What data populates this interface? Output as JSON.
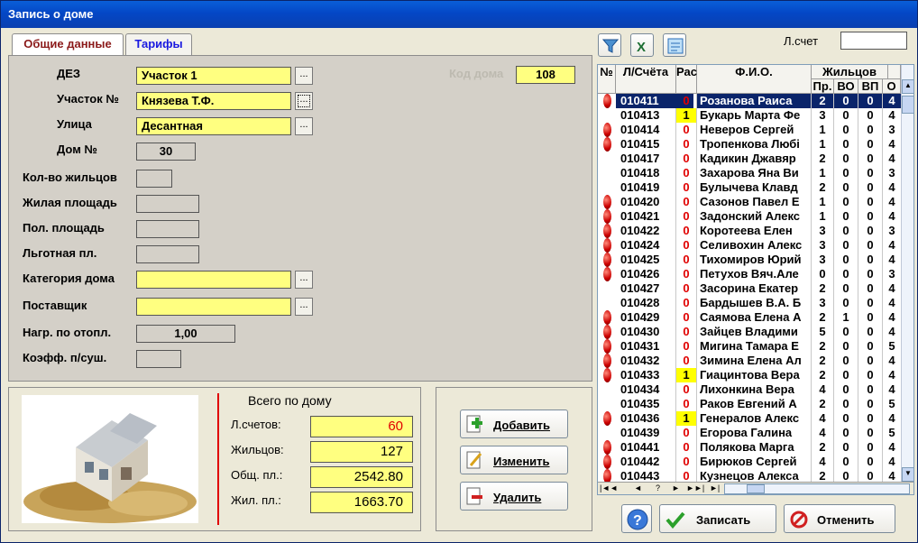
{
  "window": {
    "title": "Запись о доме"
  },
  "tabs": {
    "general": "Общие данные",
    "tariffs": "Тарифы"
  },
  "form": {
    "dez_label": "ДЕЗ",
    "dez_value": "Участок 1",
    "uchastok_label": "Участок №",
    "uchastok_value": "Князева Т.Ф.",
    "street_label": "Улица",
    "street_value": "Десантная",
    "house_label": "Дом №",
    "house_value": "30",
    "house_code_label": "Код дома",
    "house_code_value": "108",
    "residents_label": "Кол-во жильцов",
    "residents_value": "",
    "living_area_label": "Жилая площадь",
    "living_area_value": "",
    "total_area_label": "Пол. площадь",
    "total_area_value": "",
    "discount_area_label": "Льготная пл.",
    "discount_area_value": "",
    "category_label": "Категория дома",
    "category_value": "",
    "supplier_label": "Поставщик",
    "supplier_value": "",
    "heating_label": "Нагр. по отопл.",
    "heating_value": "1,00",
    "coef_label": "Коэфф. п/суш.",
    "coef_value": "",
    "dots": "..."
  },
  "summary": {
    "title": "Всего  по дому",
    "accounts_label": "Л.счетов:",
    "accounts_value": "60",
    "residents_label": "Жильцов:",
    "residents_value": "127",
    "total_area_label": "Общ. пл.:",
    "total_area_value": "2542.80",
    "living_area_label": "Жил. пл.:",
    "living_area_value": "1663.70"
  },
  "actions": {
    "add": "Добавить",
    "edit": "Изменить",
    "delete": "Удалить"
  },
  "footer": {
    "help": "?",
    "save": "Записать",
    "cancel": "Отменить"
  },
  "right": {
    "account_label": "Л.счет",
    "account_value": ""
  },
  "navigator": {
    "first": "|◄◄",
    "prev": "◄",
    "help": "?",
    "next": "►",
    "last": "►►|",
    "end": "►|"
  },
  "table": {
    "headers": {
      "num": "№",
      "account": "Л/Счёта",
      "ras": "Рас",
      "fio": "Ф.И.О.",
      "residents": "Жильцов",
      "pr": "Пр.",
      "vo": "ВО",
      "vp": "ВП",
      "o": "О"
    },
    "rows": [
      {
        "dot": true,
        "acc": "010411",
        "ras": "0",
        "fio": "Розанова Раиса",
        "c1": "2",
        "c2": "0",
        "c3": "0",
        "c4": "4",
        "sel": true
      },
      {
        "dot": false,
        "acc": "010413",
        "ras": "1",
        "fio": "Букарь Марта Фе",
        "c1": "3",
        "c2": "0",
        "c3": "0",
        "c4": "4"
      },
      {
        "dot": true,
        "acc": "010414",
        "ras": "0",
        "fio": "Неверов Сергей",
        "c1": "1",
        "c2": "0",
        "c3": "0",
        "c4": "3"
      },
      {
        "dot": true,
        "acc": "010415",
        "ras": "0",
        "fio": "Тропенкова Любі",
        "c1": "1",
        "c2": "0",
        "c3": "0",
        "c4": "4"
      },
      {
        "dot": false,
        "acc": "010417",
        "ras": "0",
        "fio": "Кадикин Джавяр",
        "c1": "2",
        "c2": "0",
        "c3": "0",
        "c4": "4"
      },
      {
        "dot": false,
        "acc": "010418",
        "ras": "0",
        "fio": "Захарова Яна Ви",
        "c1": "1",
        "c2": "0",
        "c3": "0",
        "c4": "3"
      },
      {
        "dot": false,
        "acc": "010419",
        "ras": "0",
        "fio": "Булычева Клавд",
        "c1": "2",
        "c2": "0",
        "c3": "0",
        "c4": "4"
      },
      {
        "dot": true,
        "acc": "010420",
        "ras": "0",
        "fio": "Сазонов Павел Е",
        "c1": "1",
        "c2": "0",
        "c3": "0",
        "c4": "4"
      },
      {
        "dot": true,
        "acc": "010421",
        "ras": "0",
        "fio": "Задонский Алекс",
        "c1": "1",
        "c2": "0",
        "c3": "0",
        "c4": "4"
      },
      {
        "dot": true,
        "acc": "010422",
        "ras": "0",
        "fio": "Коротеева Елен",
        "c1": "3",
        "c2": "0",
        "c3": "0",
        "c4": "3"
      },
      {
        "dot": true,
        "acc": "010424",
        "ras": "0",
        "fio": "Селивохин Алекс",
        "c1": "3",
        "c2": "0",
        "c3": "0",
        "c4": "4"
      },
      {
        "dot": true,
        "acc": "010425",
        "ras": "0",
        "fio": "Тихомиров Юрий",
        "c1": "3",
        "c2": "0",
        "c3": "0",
        "c4": "4"
      },
      {
        "dot": true,
        "acc": "010426",
        "ras": "0",
        "fio": "Петухов Вяч.Але",
        "c1": "0",
        "c2": "0",
        "c3": "0",
        "c4": "3"
      },
      {
        "dot": false,
        "acc": "010427",
        "ras": "0",
        "fio": "Засорина Екатер",
        "c1": "2",
        "c2": "0",
        "c3": "0",
        "c4": "4"
      },
      {
        "dot": false,
        "acc": "010428",
        "ras": "0",
        "fio": "Бардышев В.А. Б",
        "c1": "3",
        "c2": "0",
        "c3": "0",
        "c4": "4"
      },
      {
        "dot": true,
        "acc": "010429",
        "ras": "0",
        "fio": "Саямова Елена А",
        "c1": "2",
        "c2": "1",
        "c3": "0",
        "c4": "4"
      },
      {
        "dot": true,
        "acc": "010430",
        "ras": "0",
        "fio": "Зайцев Владими",
        "c1": "5",
        "c2": "0",
        "c3": "0",
        "c4": "4"
      },
      {
        "dot": true,
        "acc": "010431",
        "ras": "0",
        "fio": "Мигина Тамара Е",
        "c1": "2",
        "c2": "0",
        "c3": "0",
        "c4": "5"
      },
      {
        "dot": true,
        "acc": "010432",
        "ras": "0",
        "fio": "Зимина Елена Ал",
        "c1": "2",
        "c2": "0",
        "c3": "0",
        "c4": "4"
      },
      {
        "dot": true,
        "acc": "010433",
        "ras": "1",
        "fio": "Гиацинтова Вера",
        "c1": "2",
        "c2": "0",
        "c3": "0",
        "c4": "4"
      },
      {
        "dot": false,
        "acc": "010434",
        "ras": "0",
        "fio": "Лихонкина Вера",
        "c1": "4",
        "c2": "0",
        "c3": "0",
        "c4": "4"
      },
      {
        "dot": false,
        "acc": "010435",
        "ras": "0",
        "fio": "Раков Евгений А",
        "c1": "2",
        "c2": "0",
        "c3": "0",
        "c4": "5"
      },
      {
        "dot": true,
        "acc": "010436",
        "ras": "1",
        "fio": "Генералов Алекс",
        "c1": "4",
        "c2": "0",
        "c3": "0",
        "c4": "4"
      },
      {
        "dot": false,
        "acc": "010439",
        "ras": "0",
        "fio": "Егорова Галина",
        "c1": "4",
        "c2": "0",
        "c3": "0",
        "c4": "5"
      },
      {
        "dot": true,
        "acc": "010441",
        "ras": "0",
        "fio": "Полякова Марга",
        "c1": "2",
        "c2": "0",
        "c3": "0",
        "c4": "4"
      },
      {
        "dot": true,
        "acc": "010442",
        "ras": "0",
        "fio": "Бирюков Сергей",
        "c1": "4",
        "c2": "0",
        "c3": "0",
        "c4": "4"
      },
      {
        "dot": true,
        "acc": "010443",
        "ras": "0",
        "fio": "Кузнецов Алекса",
        "c1": "2",
        "c2": "0",
        "c3": "0",
        "c4": "4"
      }
    ]
  },
  "colors": {
    "field_yellow": "#FFFF80",
    "selection": "#0A246A",
    "ras_zero": "#E00000",
    "ras_one_bg": "#FFFF00"
  }
}
